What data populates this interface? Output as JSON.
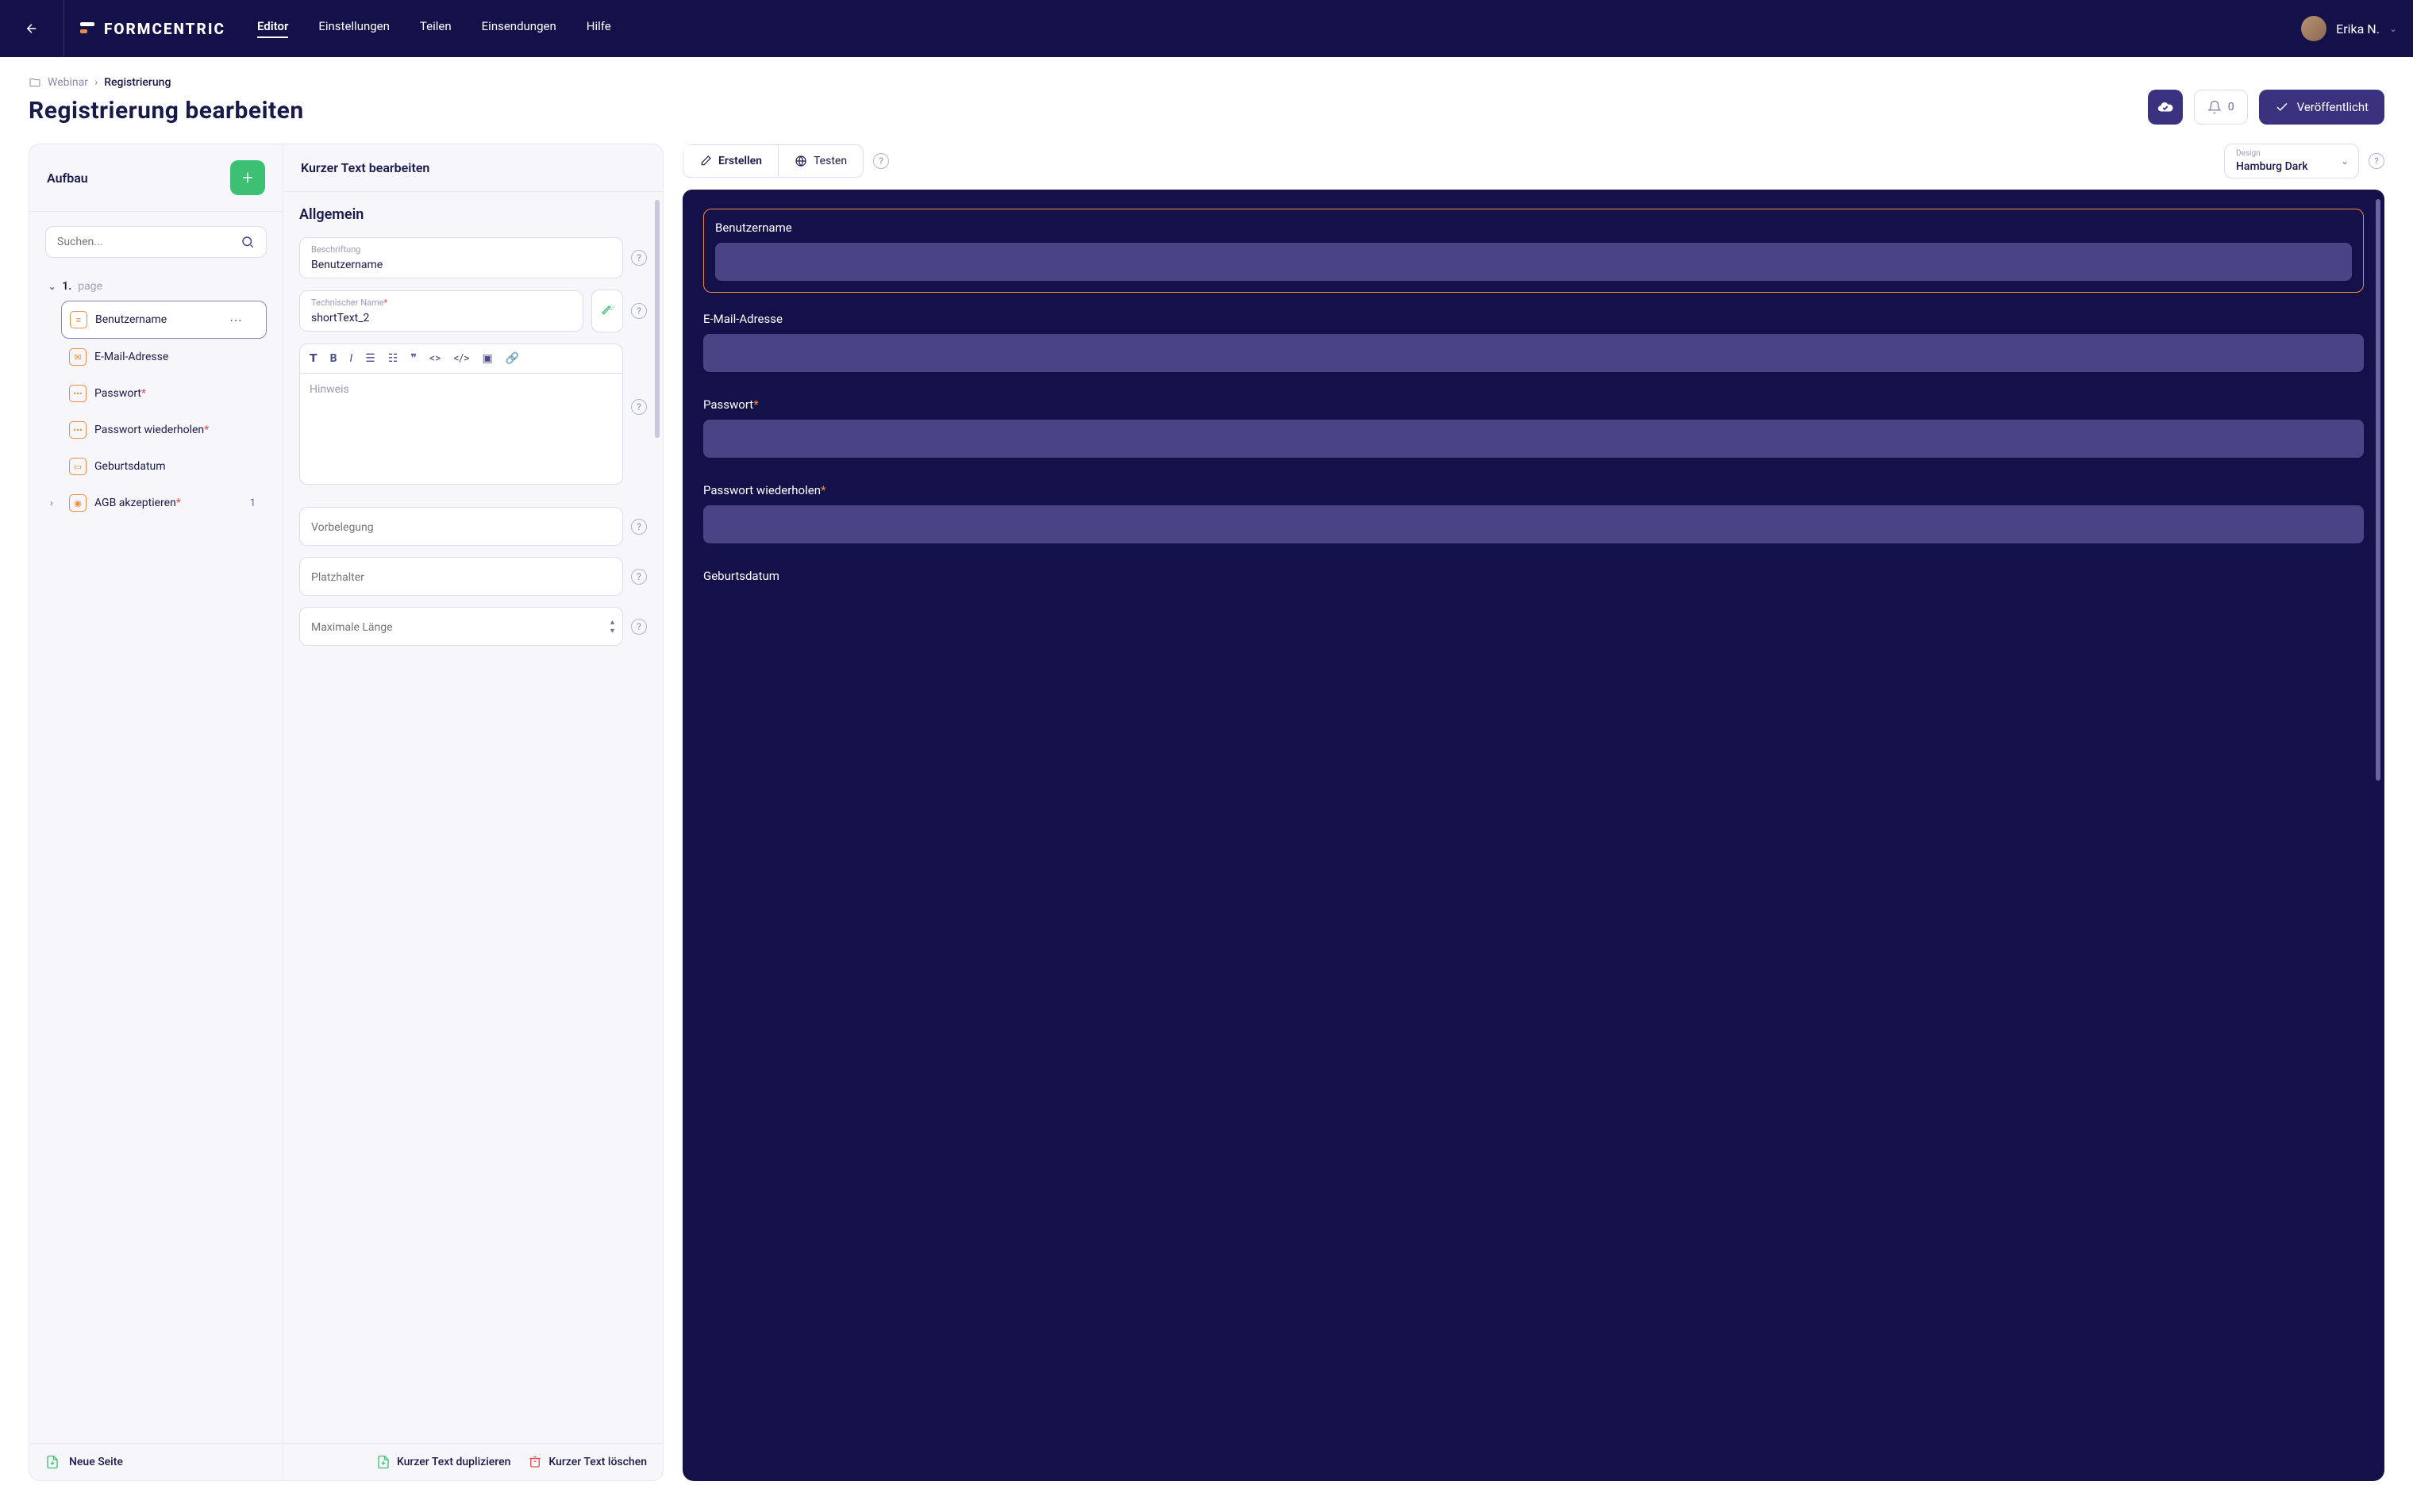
{
  "brand": "FORMCENTRIC",
  "nav": {
    "items": [
      {
        "label": "Editor",
        "active": true
      },
      {
        "label": "Einstellungen",
        "active": false
      },
      {
        "label": "Teilen",
        "active": false
      },
      {
        "label": "Einsendungen",
        "active": false
      },
      {
        "label": "Hilfe",
        "active": false
      }
    ]
  },
  "user": {
    "name": "Erika N."
  },
  "breadcrumb": {
    "parent": "Webinar",
    "current": "Registrierung"
  },
  "pageTitle": "Registrierung bearbeiten",
  "header": {
    "notifCount": "0",
    "publishLabel": "Veröffentlicht"
  },
  "structure": {
    "title": "Aufbau",
    "searchPlaceholder": "Suchen...",
    "page": {
      "prefix": "1.",
      "suffix": "page"
    },
    "items": [
      {
        "icon": "≡",
        "label": "Benutzername",
        "required": false,
        "selected": true,
        "expandable": false
      },
      {
        "icon": "✉",
        "label": "E-Mail-Adresse",
        "required": false,
        "selected": false,
        "expandable": false
      },
      {
        "icon": "•••",
        "label": "Passwort",
        "required": true,
        "selected": false,
        "expandable": false
      },
      {
        "icon": "•••",
        "label": "Passwort wiederholen",
        "required": true,
        "selected": false,
        "expandable": false
      },
      {
        "icon": "📅",
        "label": "Geburtsdatum",
        "required": false,
        "selected": false,
        "expandable": false
      },
      {
        "icon": "◉",
        "label": "AGB akzeptieren",
        "required": true,
        "selected": false,
        "expandable": true,
        "badge": "1"
      }
    ],
    "footerAction": "Neue Seite"
  },
  "editor": {
    "title": "Kurzer Text bearbeiten",
    "sectionTitle": "Allgemein",
    "fields": {
      "labelLabel": "Beschriftung",
      "labelValue": "Benutzername",
      "techLabel": "Technischer Name",
      "techValue": "shortText_2",
      "hintPlaceholder": "Hinweis",
      "prefillPlaceholder": "Vorbelegung",
      "placeholderPlaceholder": "Platzhalter",
      "maxlenPlaceholder": "Maximale Länge"
    },
    "footer": {
      "duplicate": "Kurzer Text duplizieren",
      "delete": "Kurzer Text löschen"
    }
  },
  "preview": {
    "tabs": {
      "create": "Erstellen",
      "test": "Testen"
    },
    "design": {
      "label": "Design",
      "value": "Hamburg Dark"
    },
    "fields": [
      {
        "label": "Benutzername",
        "required": false,
        "highlighted": true
      },
      {
        "label": "E-Mail-Adresse",
        "required": false,
        "highlighted": false
      },
      {
        "label": "Passwort",
        "required": true,
        "highlighted": false
      },
      {
        "label": "Passwort wiederholen",
        "required": true,
        "highlighted": false
      },
      {
        "label": "Geburtsdatum",
        "required": false,
        "highlighted": false
      }
    ]
  }
}
